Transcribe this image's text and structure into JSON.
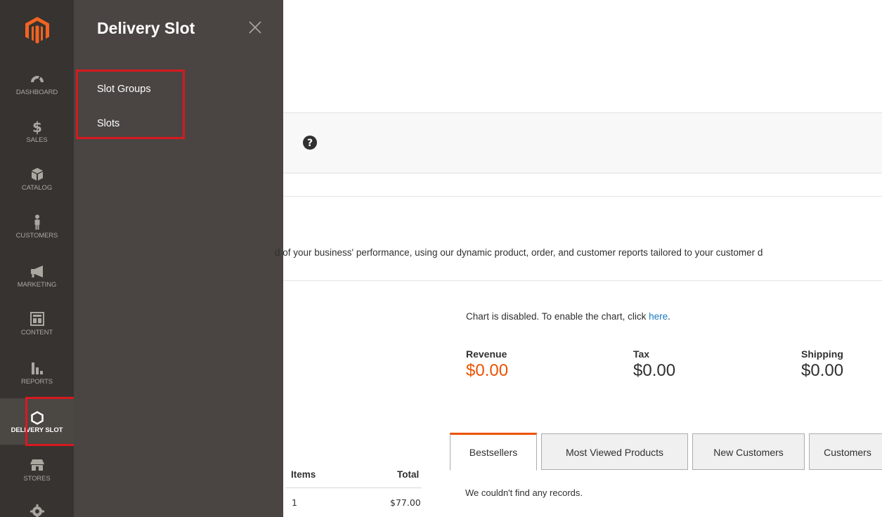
{
  "nav": {
    "items": [
      {
        "key": "dashboard",
        "label": "DASHBOARD",
        "icon": "dashboard-icon"
      },
      {
        "key": "sales",
        "label": "SALES",
        "icon": "dollar-icon"
      },
      {
        "key": "catalog",
        "label": "CATALOG",
        "icon": "cube-icon"
      },
      {
        "key": "customers",
        "label": "CUSTOMERS",
        "icon": "person-icon"
      },
      {
        "key": "marketing",
        "label": "MARKETING",
        "icon": "megaphone-icon"
      },
      {
        "key": "content",
        "label": "CONTENT",
        "icon": "layout-icon"
      },
      {
        "key": "reports",
        "label": "REPORTS",
        "icon": "bar-chart-icon"
      },
      {
        "key": "delivery-slot",
        "label": "DELIVERY SLOT",
        "icon": "hexagon-icon"
      },
      {
        "key": "stores",
        "label": "STORES",
        "icon": "store-icon"
      },
      {
        "key": "system",
        "label": "",
        "icon": "gear-icon"
      }
    ],
    "active": "delivery-slot"
  },
  "flyout": {
    "title": "Delivery Slot",
    "items": [
      "Slot Groups",
      "Slots"
    ]
  },
  "main": {
    "intro": "d of your business' performance, using our dynamic product, order, and customer reports tailored to your customer d",
    "chart_msg": "Chart is disabled. To enable the chart, click ",
    "chart_link": "here",
    "chart_msg_end": ".",
    "stats": [
      {
        "label": "Revenue",
        "value": "$0.00"
      },
      {
        "label": "Tax",
        "value": "$0.00"
      },
      {
        "label": "Shipping",
        "value": "$0.00"
      }
    ],
    "orders_table": {
      "headers": [
        "Items",
        "Total"
      ],
      "rows": [
        [
          "1",
          "$77.00"
        ]
      ]
    },
    "tabs": [
      "Bestsellers",
      "Most Viewed Products",
      "New Customers",
      "Customers"
    ],
    "no_records": "We couldn't find any records."
  },
  "colors": {
    "nav_bg": "#373330",
    "flyout_bg": "#4a4542",
    "accent": "#eb5202",
    "highlight": "#d71920",
    "link": "#1979c3"
  }
}
